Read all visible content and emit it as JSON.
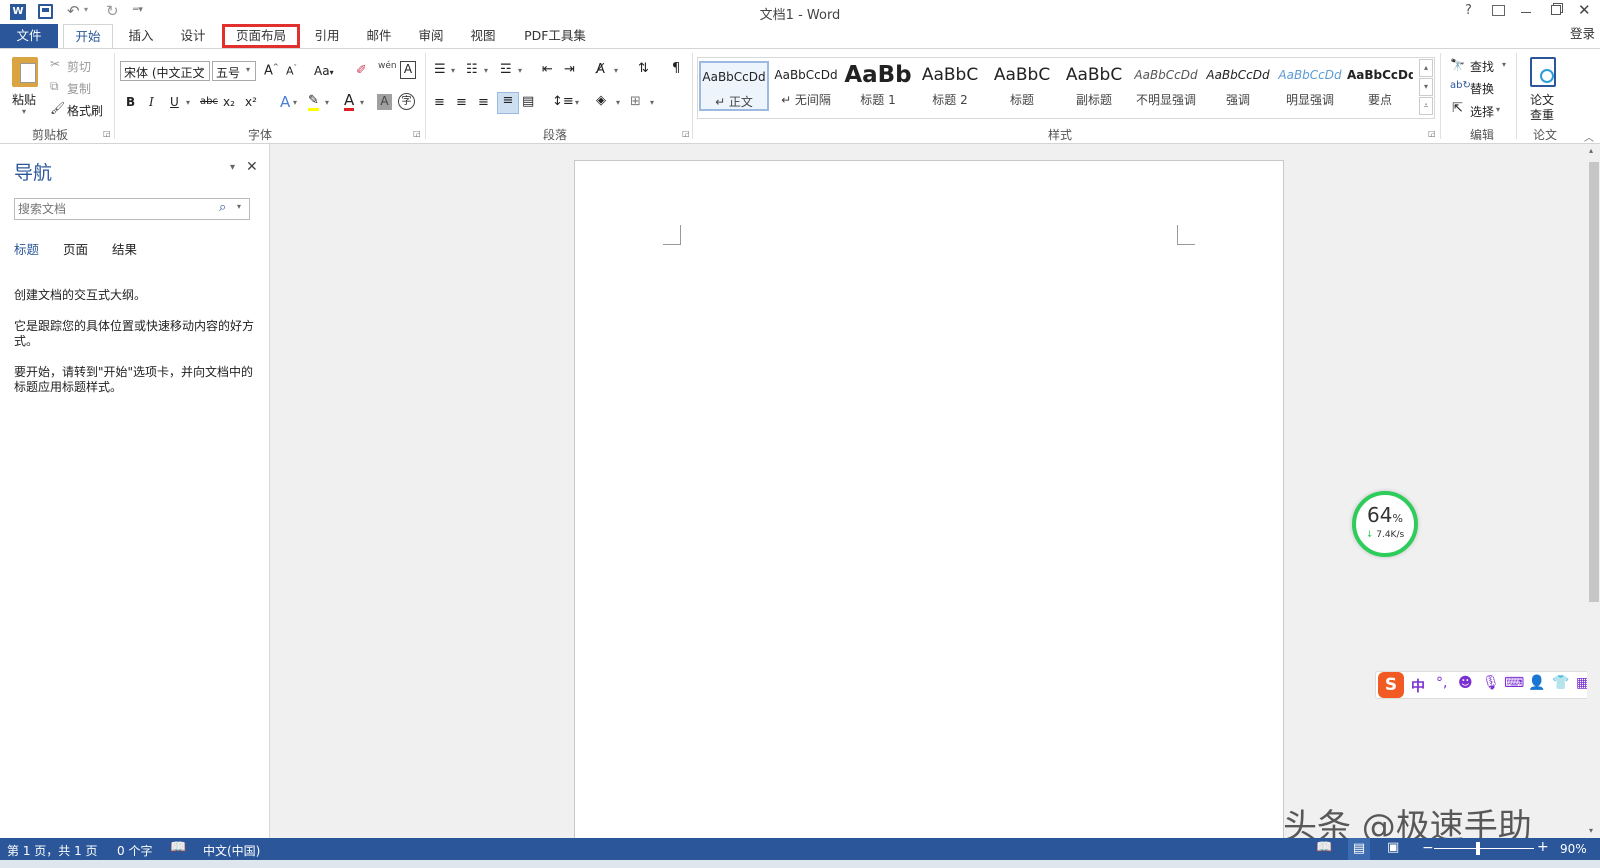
{
  "window": {
    "title": "文档1 - Word",
    "help": "?",
    "signin": "登录"
  },
  "tabs": {
    "file": "文件",
    "home": "开始",
    "insert": "插入",
    "design": "设计",
    "layout": "页面布局",
    "references": "引用",
    "mailings": "邮件",
    "review": "审阅",
    "view": "视图",
    "pdf": "PDF工具集"
  },
  "clipboard": {
    "paste": "粘贴",
    "cut": "剪切",
    "copy": "复制",
    "format_painter": "格式刷",
    "label": "剪贴板"
  },
  "font": {
    "name": "宋体 (中文正文",
    "size": "五号",
    "label": "字体",
    "case_btn": "Aa",
    "bold": "B",
    "italic": "I",
    "underline": "U",
    "strike": "abc",
    "sub": "x₂",
    "sup": "x²",
    "phonetic": "wén",
    "charborder": "A",
    "effects": "A",
    "fontcolor": "A",
    "shading": "A",
    "enclose": "字"
  },
  "paragraph": {
    "label": "段落"
  },
  "styles": {
    "label": "样式",
    "items": [
      {
        "sample": "AaBbCcDd",
        "name": "↵ 正文"
      },
      {
        "sample": "AaBbCcDd",
        "name": "↵ 无间隔"
      },
      {
        "sample": "AaBb",
        "name": "标题 1"
      },
      {
        "sample": "AaBbC",
        "name": "标题 2"
      },
      {
        "sample": "AaBbC",
        "name": "标题"
      },
      {
        "sample": "AaBbC",
        "name": "副标题"
      },
      {
        "sample": "AaBbCcDd",
        "name": "不明显强调"
      },
      {
        "sample": "AaBbCcDd",
        "name": "强调"
      },
      {
        "sample": "AaBbCcDd",
        "name": "明显强调"
      },
      {
        "sample": "AaBbCcDd",
        "name": "要点"
      }
    ]
  },
  "editing": {
    "find": "查找",
    "replace": "替换",
    "select": "选择",
    "label": "编辑"
  },
  "paper": {
    "check1": "论文",
    "check2": "查重",
    "label": "论文"
  },
  "nav": {
    "title": "导航",
    "search_placeholder": "搜索文档",
    "tabs": [
      "标题",
      "页面",
      "结果"
    ],
    "p1": "创建文档的交互式大纲。",
    "p2": "它是跟踪您的具体位置或快速移动内容的好方式。",
    "p3": "要开始，请转到\"开始\"选项卡，并向文档中的标题应用标题样式。"
  },
  "speed_widget": {
    "percent": "64",
    "unit": "%",
    "speed": "7.4K/s"
  },
  "watermark": "头条 @极速手助",
  "ime": {
    "lang": "中"
  },
  "status": {
    "page": "第 1 页，共 1 页",
    "words": "0 个字",
    "language": "中文(中国)",
    "zoom": "90%"
  },
  "colors": {
    "accent": "#2b579a",
    "highlight_box": "#e03030",
    "speed_ring": "#2ecc5a",
    "ime_purple": "#7a2fd0",
    "sogou_orange": "#f15a22"
  }
}
